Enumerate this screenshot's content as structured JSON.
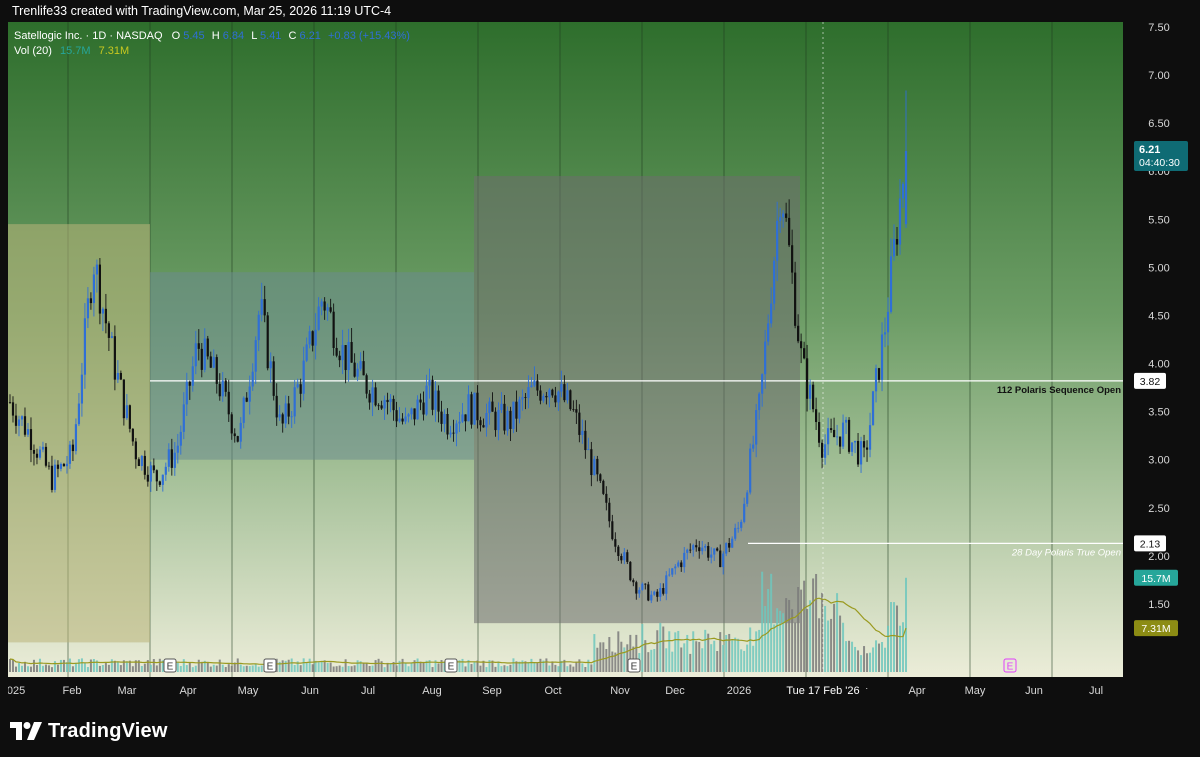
{
  "header": {
    "attribution": "Trenlife33 created with TradingView.com, Mar 25, 2026 11:19 UTC-4"
  },
  "legend": {
    "symbol": "Satellogic Inc. · 1D · NASDAQ",
    "o_label": "O",
    "o_value": "5.45",
    "h_label": "H",
    "h_value": "6.84",
    "l_label": "L",
    "l_value": "5.41",
    "c_label": "C",
    "c_value": "6.21",
    "change": "+0.83 (+15.43%)",
    "vol_label": "Vol (20)",
    "vol_value": "15.7M",
    "vol_ma": "7.31M"
  },
  "colors": {
    "up": "#2f6fd6",
    "down": "#111111",
    "ma": "#9a9a20",
    "price_tag": "#0f6b74",
    "vol_tag": "#26a69a",
    "ma_tag": "#8c8c14",
    "bg_top": "#2e6e2c",
    "bg_bottom": "#ececd6"
  },
  "footer": {
    "brand": "TradingView",
    "logo": "tradingview-logo-icon"
  },
  "chart_data": {
    "type": "candlestick",
    "symbol": "Satellogic Inc.",
    "interval": "1D",
    "ylim": [
      1.0,
      7.5
    ],
    "y_ticks": [
      "7.50",
      "7.00",
      "6.50",
      "6.00",
      "5.50",
      "5.00",
      "4.50",
      "4.00",
      "3.50",
      "3.00",
      "2.50",
      "2.00",
      "1.50"
    ],
    "x_ticks": [
      "2025",
      "Feb",
      "Mar",
      "Apr",
      "May",
      "Jun",
      "Jul",
      "Aug",
      "Sep",
      "Oct",
      "Nov",
      "Dec",
      "2026",
      "Feb",
      "Mar",
      "Apr",
      "May",
      "Jun",
      "Jul"
    ],
    "crosshair_date": "Tue 17 Feb '26",
    "last_price": {
      "value": "6.21",
      "countdown": "04:40:30"
    },
    "ohlc_path": [
      [
        0,
        3.6
      ],
      [
        1,
        3.25
      ],
      [
        2,
        2.8
      ],
      [
        3,
        3.05
      ],
      [
        4,
        5.1
      ],
      [
        5,
        4.0
      ],
      [
        6,
        3.1
      ],
      [
        7,
        2.8
      ],
      [
        8,
        3.1
      ],
      [
        9,
        4.2
      ],
      [
        10,
        3.8
      ],
      [
        11,
        3.2
      ],
      [
        12,
        4.6
      ],
      [
        13,
        3.3
      ],
      [
        14,
        3.85
      ],
      [
        15,
        4.7
      ],
      [
        16,
        4.1
      ],
      [
        17,
        3.8
      ],
      [
        18,
        3.65
      ],
      [
        19,
        3.35
      ],
      [
        20,
        3.7
      ],
      [
        21,
        3.4
      ],
      [
        22,
        3.55
      ],
      [
        23,
        3.45
      ],
      [
        24,
        3.4
      ],
      [
        25,
        3.7
      ],
      [
        26,
        3.8
      ],
      [
        27,
        3.5
      ],
      [
        28,
        2.9
      ],
      [
        29,
        2.2
      ],
      [
        30,
        1.7
      ],
      [
        31,
        1.55
      ],
      [
        32,
        1.9
      ],
      [
        33,
        2.15
      ],
      [
        34,
        1.95
      ],
      [
        35,
        2.3
      ],
      [
        36,
        3.6
      ],
      [
        37,
        5.9
      ],
      [
        38,
        4.0
      ],
      [
        39,
        3.15
      ],
      [
        40,
        3.3
      ],
      [
        41,
        3.0
      ],
      [
        42,
        4.4
      ],
      [
        43,
        6.21
      ]
    ],
    "horizontal_levels": [
      {
        "label": "112 Polaris Sequence Open",
        "value": 3.82
      },
      {
        "label": "28 Day Polaris True Open",
        "value": 2.13
      }
    ],
    "boxes": [
      {
        "from": "2025-01",
        "to": "2025-03-mid",
        "low": 1.1,
        "high": 5.45,
        "fill": "#b9b47a"
      },
      {
        "from": "2025-03-mid",
        "to": "2025-08-end",
        "low": 3.0,
        "high": 4.95,
        "fill": "#6b8c8e"
      },
      {
        "from": "2025-08-end",
        "to": "2026-01-end",
        "low": 1.3,
        "high": 5.95,
        "fill": "#6e6e6e"
      }
    ],
    "volume": {
      "last": "15.7M",
      "ma20": "7.31M",
      "ylim_m": [
        0,
        20
      ]
    },
    "earnings_markers": [
      "Mar",
      "May",
      "Aug",
      "Nov",
      "Mar"
    ]
  }
}
